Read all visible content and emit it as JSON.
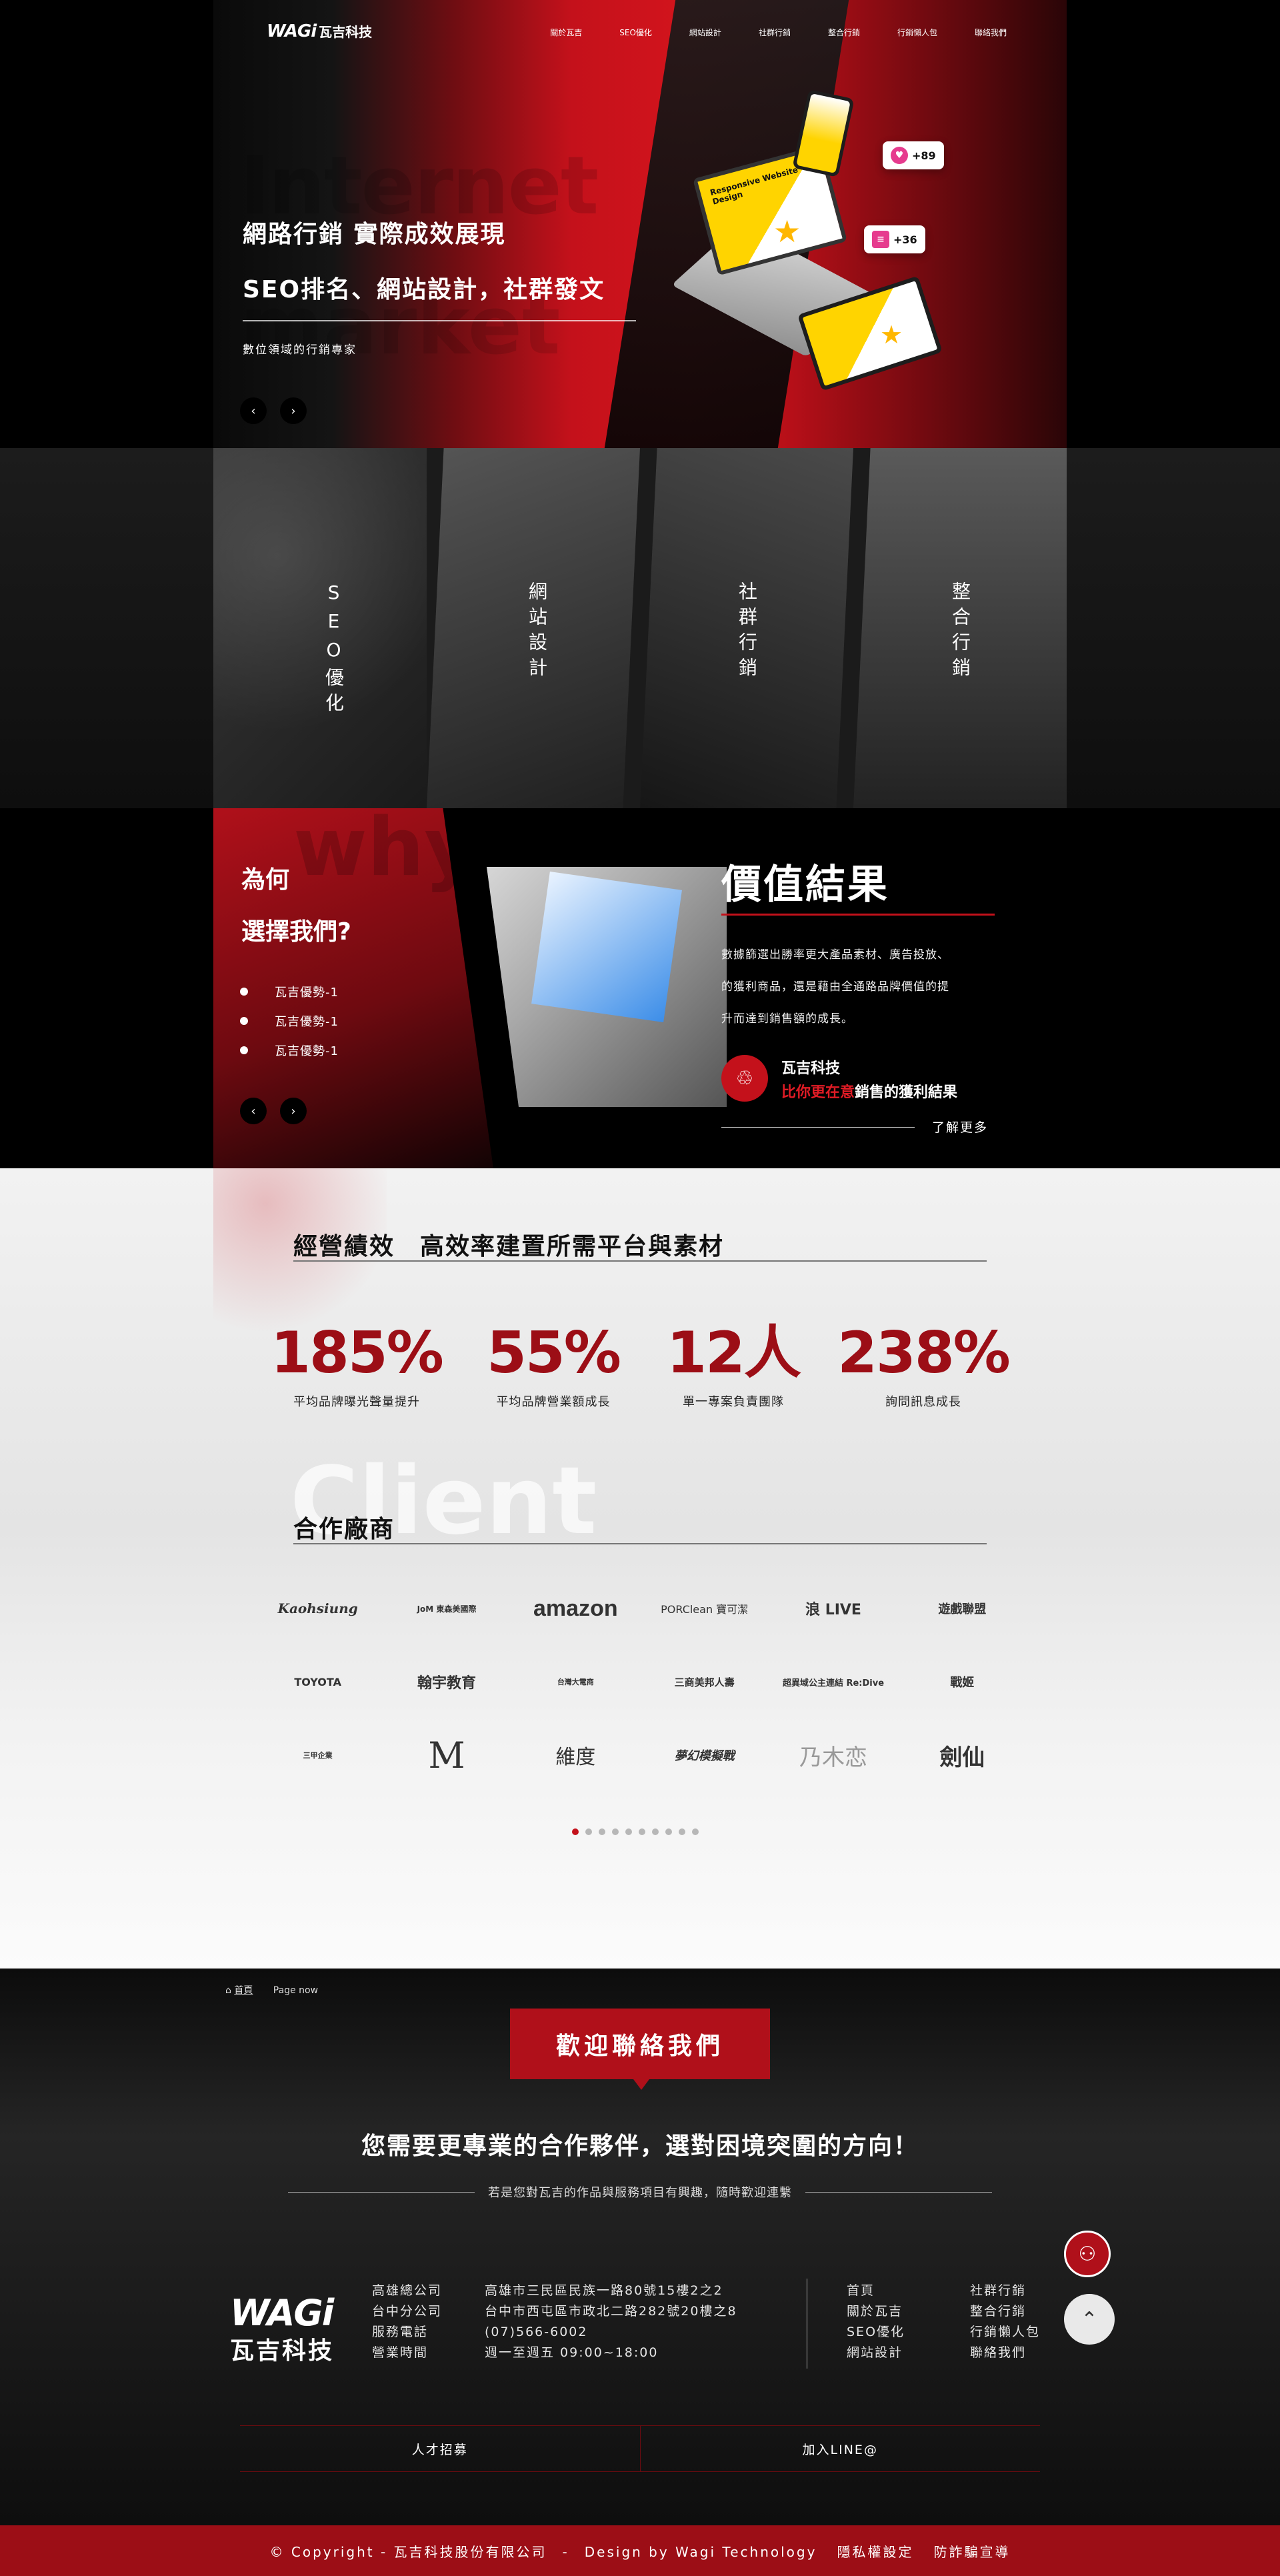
{
  "brand": {
    "logo_latin": "WAGi",
    "logo_zh": "瓦吉科技"
  },
  "nav": [
    "關於瓦吉",
    "SEO優化",
    "網站設計",
    "社群行銷",
    "整合行銷",
    "行銷懶人包",
    "聯絡我們"
  ],
  "hero": {
    "bg_word_1": "Internet",
    "bg_word_2": "market",
    "line1": "網路行銷 實際成效展現",
    "line2": "SEO排名、網站設計，社群發文",
    "sub": "數位領域的行銷專家",
    "prev": "‹",
    "next": "›",
    "bubble_likes": "+89",
    "bubble_msgs": "+36",
    "screen_text": "Responsive Website Design"
  },
  "services": [
    "SEO優化",
    "網站設計",
    "社群行銷",
    "整合行銷"
  ],
  "why": {
    "bg_word": "why",
    "title1": "為何",
    "title2": "選擇我們?",
    "items": [
      "瓦吉優勢-1",
      "瓦吉優勢-1",
      "瓦吉優勢-1"
    ],
    "value_title": "價值結果",
    "value_text1": "數據篩選出勝率更大產品素材、廣告投放、",
    "value_text2": "的獲利商品，還是藉由全通路品牌價值的提",
    "value_text3": "升而達到銷售額的成長。",
    "company": "瓦吉科技",
    "slogan_red": "比你更在意",
    "slogan_white": "銷售的獲利結果",
    "more": "了解更多"
  },
  "stats": {
    "title": "經營績效　高效率建置所需平台與素材",
    "items": [
      {
        "num": "185%",
        "label": "平均品牌曝光聲量提升"
      },
      {
        "num": "55%",
        "label": "平均品牌營業額成長"
      },
      {
        "num": "12人",
        "label": "單一專案負責團隊"
      },
      {
        "num": "238%",
        "label": "詢問訊息成長"
      }
    ]
  },
  "clients": {
    "bg_word": "Client",
    "title": "合作廠商",
    "logos": [
      "Kaohsiung",
      "JoM 東森美國際",
      "amazon",
      "PORClean 寶可潔",
      "浪 LIVE",
      "遊戲聯盟",
      "TOYOTA",
      "翰宇教育",
      "台灣大電商",
      "三商美邦人壽",
      "超異域公主連結 Re:Dive",
      "戰姬",
      "三甲企業",
      "M",
      "維度",
      "夢幻模擬戰",
      "乃木恋",
      "劍仙"
    ],
    "page_count": 10,
    "active_page": 0
  },
  "contact": {
    "crumb_home": "首頁",
    "crumb_now": "Page now",
    "badge": "歡迎聯絡我們",
    "heading": "您需要更專業的合作夥伴，選對困境突圍的方向！",
    "sub": "若是您對瓦吉的作品與服務項目有興趣，隨時歡迎連繫",
    "info_labels": [
      "高雄總公司",
      "台中分公司",
      "服務電話",
      "營業時間"
    ],
    "info_values": [
      "高雄市三民區民族一路80號15樓2之2",
      "台中市西屯區市政北二路282號20樓之8",
      "(07)566-6002",
      "週一至週五 09:00~18:00"
    ],
    "links_col1": [
      "首頁",
      "關於瓦吉",
      "SEO優化",
      "網站設計"
    ],
    "links_col2": [
      "社群行銷",
      "整合行銷",
      "行銷懶人包",
      "聯絡我們"
    ],
    "bottom_left": "人才招募",
    "bottom_right": "加入LINE@",
    "top_btn": "⌃"
  },
  "copyright": {
    "text": "© Copyright - 瓦吉科技股份有限公司　-　Design by Wagi Technology",
    "privacy": "隱私權設定",
    "fraud": "防詐騙宣導"
  },
  "colors": {
    "brand_red": "#c4111b",
    "deep_red": "#9c0e16",
    "yellow": "#ffd400"
  }
}
